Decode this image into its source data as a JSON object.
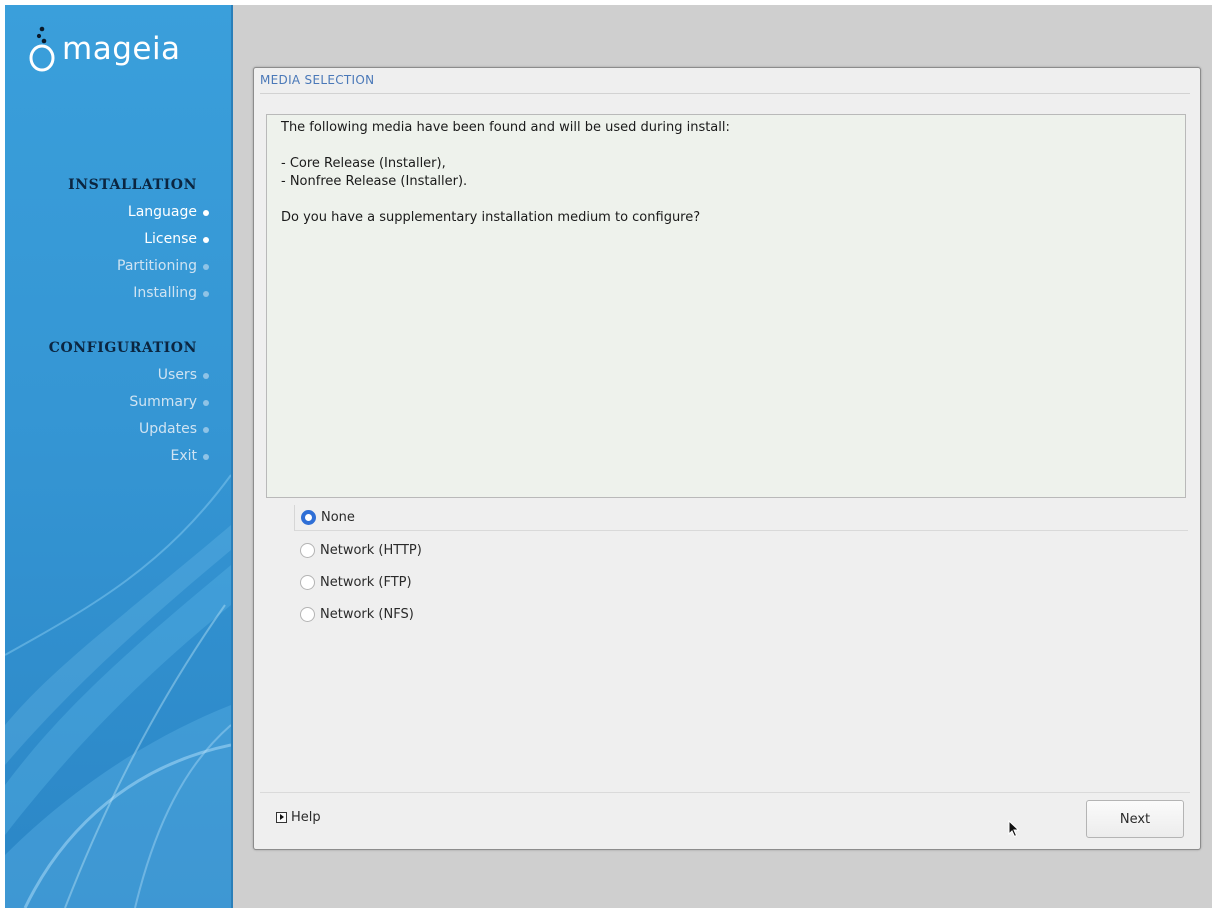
{
  "sidebar": {
    "logo_text": "mageia",
    "installation_heading": "INSTALLATION",
    "installation_items": [
      {
        "label": "Language",
        "state": "done"
      },
      {
        "label": "License",
        "state": "done"
      },
      {
        "label": "Partitioning",
        "state": "pending"
      },
      {
        "label": "Installing",
        "state": "pending"
      }
    ],
    "configuration_heading": "CONFIGURATION",
    "configuration_items": [
      {
        "label": "Users",
        "state": "pending"
      },
      {
        "label": "Summary",
        "state": "pending"
      },
      {
        "label": "Updates",
        "state": "pending"
      },
      {
        "label": "Exit",
        "state": "pending"
      }
    ]
  },
  "dialog": {
    "title": "MEDIA SELECTION",
    "message": {
      "intro": "The following media have been found and will be used during install:",
      "media": [
        "- Core Release (Installer),",
        "- Nonfree Release (Installer)."
      ],
      "question": "Do you have a supplementary installation medium to configure?"
    },
    "options": [
      {
        "label": "None",
        "selected": true
      },
      {
        "label": "Network (HTTP)",
        "selected": false
      },
      {
        "label": "Network (FTP)",
        "selected": false
      },
      {
        "label": "Network (NFS)",
        "selected": false
      }
    ],
    "help_label": "Help",
    "next_label": "Next"
  },
  "colors": {
    "sidebar_blue": "#3596d4",
    "heading_navy": "#0b2540",
    "title_blue": "#4a78b8",
    "radio_selected": "#2f6fd6"
  },
  "icons": [
    "mageia-logo-icon",
    "radio-icon",
    "help-expander-icon",
    "mouse-pointer-icon"
  ]
}
